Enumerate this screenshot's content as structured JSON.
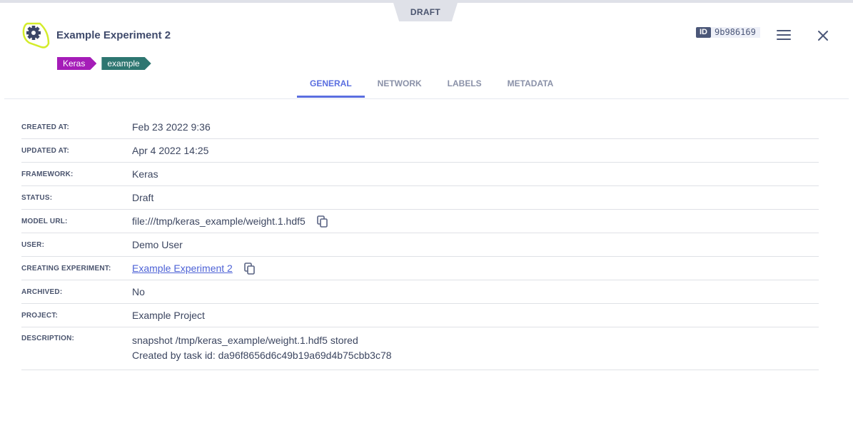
{
  "header": {
    "status_badge": "DRAFT",
    "title": "Example Experiment 2",
    "id_label": "ID",
    "id_value": "9b986169",
    "tags": [
      {
        "label": "Keras",
        "color": "#a51db8"
      },
      {
        "label": "example",
        "color": "#2e7671"
      }
    ],
    "icons": [
      "experiment-gear-icon",
      "menu-icon",
      "close-icon"
    ]
  },
  "tabs": [
    {
      "label": "GENERAL",
      "active": true
    },
    {
      "label": "NETWORK",
      "active": false
    },
    {
      "label": "LABELS",
      "active": false
    },
    {
      "label": "METADATA",
      "active": false
    }
  ],
  "details": {
    "created_at": {
      "label": "CREATED AT:",
      "value": "Feb 23 2022 9:36"
    },
    "updated_at": {
      "label": "UPDATED AT:",
      "value": "Apr 4 2022 14:25"
    },
    "framework": {
      "label": "FRAMEWORK:",
      "value": "Keras"
    },
    "status": {
      "label": "STATUS:",
      "value": "Draft"
    },
    "model_url": {
      "label": "MODEL URL:",
      "value": "file:///tmp/keras_example/weight.1.hdf5"
    },
    "user": {
      "label": "USER:",
      "value": "Demo User"
    },
    "creating_experiment": {
      "label": "CREATING EXPERIMENT:",
      "value": "Example Experiment 2"
    },
    "archived": {
      "label": "ARCHIVED:",
      "value": "No"
    },
    "project": {
      "label": "PROJECT:",
      "value": "Example Project"
    },
    "description": {
      "label": "DESCRIPTION:",
      "lines": [
        "snapshot /tmp/keras_example/weight.1.hdf5 stored",
        "Created by task id: da96f8656d6c49b19a69d4b75cbb3c78"
      ]
    }
  },
  "colors": {
    "accent": "#5a6ee0",
    "link": "#4d62d6",
    "icon_highlight": "#d4ec2a"
  }
}
